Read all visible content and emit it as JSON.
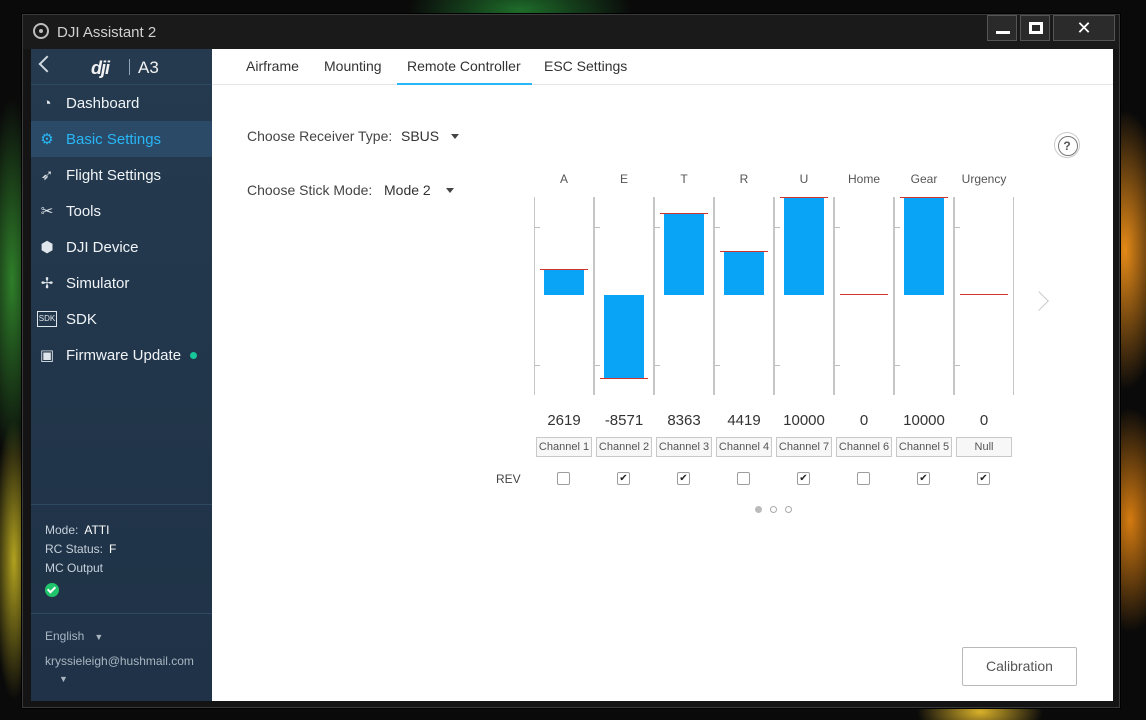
{
  "window": {
    "title": "DJI Assistant 2",
    "min": "—",
    "max": "▢",
    "close": "✕"
  },
  "sidebar": {
    "brand": "dji",
    "model": "A3",
    "items": [
      {
        "label": "Dashboard",
        "icon": "dashboard-icon"
      },
      {
        "label": "Basic Settings",
        "icon": "gear-icon",
        "active": true
      },
      {
        "label": "Flight Settings",
        "icon": "rocket-icon"
      },
      {
        "label": "Tools",
        "icon": "tools-icon"
      },
      {
        "label": "DJI Device",
        "icon": "cube-icon"
      },
      {
        "label": "Simulator",
        "icon": "drone-icon"
      },
      {
        "label": "SDK",
        "icon": "sdk-icon"
      },
      {
        "label": "Firmware Update",
        "icon": "firmware-icon"
      }
    ],
    "status": {
      "mode_label": "Mode:",
      "mode_value": "ATTI",
      "rc_label": "RC Status:",
      "rc_value": "F",
      "mc_label": "MC Output"
    },
    "language": "English",
    "account": "kryssieleigh@hushmail.com"
  },
  "tabs": [
    "Airframe",
    "Mounting",
    "Remote Controller",
    "ESC Settings"
  ],
  "form": {
    "receiver_label": "Choose Receiver Type:",
    "receiver_value": "SBUS",
    "stick_label": "Choose Stick Mode:",
    "stick_value": "Mode 2"
  },
  "channels": [
    {
      "name": "A",
      "value": 2619,
      "source": "Channel 1",
      "rev": false
    },
    {
      "name": "E",
      "value": -8571,
      "source": "Channel 2",
      "rev": true
    },
    {
      "name": "T",
      "value": 8363,
      "source": "Channel 3",
      "rev": true
    },
    {
      "name": "R",
      "value": 4419,
      "source": "Channel 4",
      "rev": false
    },
    {
      "name": "U",
      "value": 10000,
      "source": "Channel 7",
      "rev": true
    },
    {
      "name": "Home",
      "value": 0,
      "source": "Channel 6",
      "rev": false
    },
    {
      "name": "Gear",
      "value": 10000,
      "source": "Channel 5",
      "rev": true
    },
    {
      "name": "Urgency",
      "value": 0,
      "source": "Null",
      "rev": true
    }
  ],
  "channel_range": [
    -10000,
    10000
  ],
  "rev_label": "REV",
  "calibration_label": "Calibration",
  "colors": {
    "accent": "#29b6f6",
    "bar": "#0aa4f6",
    "marker": "#d2322e",
    "sidebar": "#253a4f"
  }
}
